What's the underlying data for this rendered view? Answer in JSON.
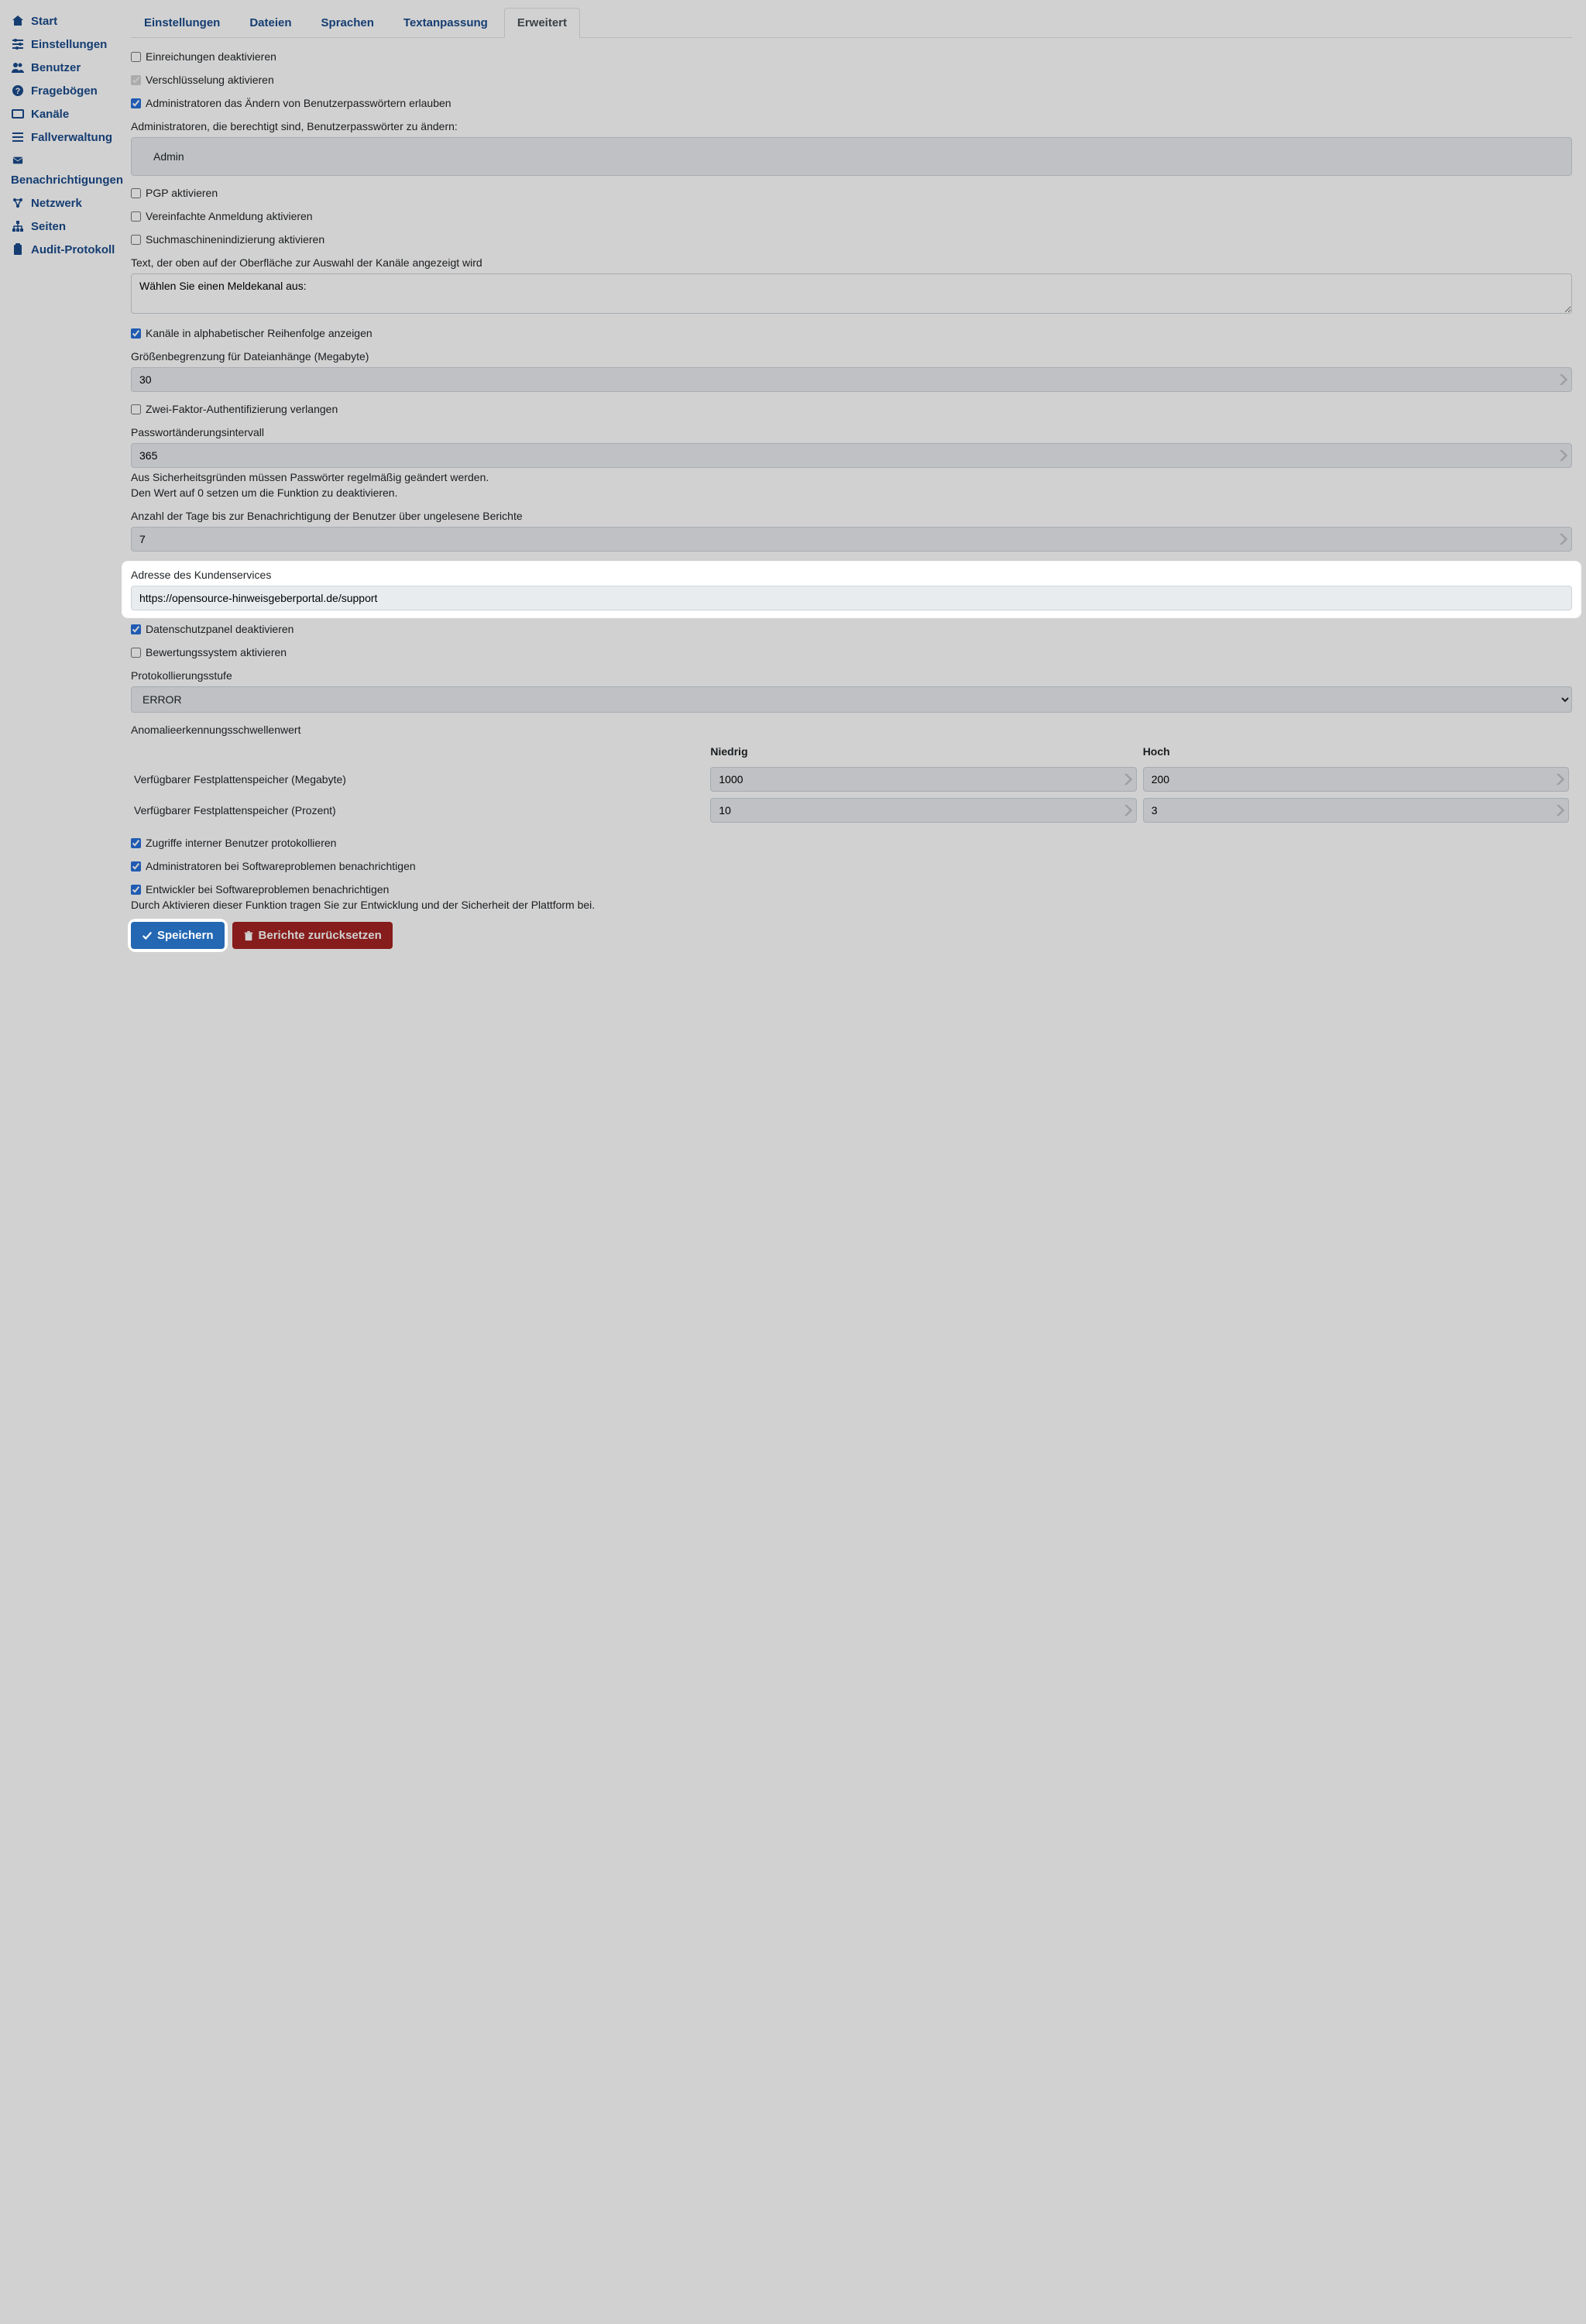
{
  "sidebar": {
    "items": [
      {
        "icon": "home",
        "label": "Start"
      },
      {
        "icon": "sliders",
        "label": "Einstellungen"
      },
      {
        "icon": "users",
        "label": "Benutzer"
      },
      {
        "icon": "question",
        "label": "Fragebögen"
      },
      {
        "icon": "inbox",
        "label": "Kanäle"
      },
      {
        "icon": "list",
        "label": "Fallverwaltung"
      },
      {
        "icon": "envelope",
        "label": "Benachrichtigungen"
      },
      {
        "icon": "cloud",
        "label": "Netzwerk"
      },
      {
        "icon": "sitemap",
        "label": "Seiten"
      },
      {
        "icon": "clipboard",
        "label": "Audit-Protokoll"
      }
    ]
  },
  "tabs": [
    "Einstellungen",
    "Dateien",
    "Sprachen",
    "Textanpassung",
    "Erweitert"
  ],
  "active_tab": "Erweitert",
  "form": {
    "disable_submissions": {
      "label": "Einreichungen deaktivieren",
      "checked": false
    },
    "enable_encryption": {
      "label": "Verschlüsselung aktivieren",
      "checked": true,
      "disabled": true
    },
    "allow_admin_pw_change": {
      "label": "Administratoren das Ändern von Benutzerpasswörtern erlauben",
      "checked": true
    },
    "admins_allowed_label": "Administratoren, die berechtigt sind, Benutzerpasswörter zu ändern:",
    "admins_allowed_value": "Admin",
    "enable_pgp": {
      "label": "PGP aktivieren",
      "checked": false
    },
    "simplified_login": {
      "label": "Vereinfachte Anmeldung aktivieren",
      "checked": false
    },
    "search_indexing": {
      "label": "Suchmaschinenindizierung aktivieren",
      "checked": false
    },
    "channel_text_label": "Text, der oben auf der Oberfläche zur Auswahl der Kanäle angezeigt wird",
    "channel_text_value": "Wählen Sie einen Meldekanal aus:",
    "channels_alpha": {
      "label": "Kanäle in alphabetischer Reihenfolge anzeigen",
      "checked": true
    },
    "attachment_size_label": "Größenbegrenzung für Dateianhänge (Megabyte)",
    "attachment_size_value": "30",
    "require_2fa": {
      "label": "Zwei-Faktor-Authentifizierung verlangen",
      "checked": false
    },
    "pw_interval_label": "Passwortänderungsintervall",
    "pw_interval_value": "365",
    "pw_interval_help1": "Aus Sicherheitsgründen müssen Passwörter regelmäßig geändert werden.",
    "pw_interval_help2": "Den Wert auf 0 setzen um die Funktion zu deaktivieren.",
    "unread_days_label": "Anzahl der Tage bis zur Benachrichtigung der Benutzer über ungelesene Berichte",
    "unread_days_value": "7",
    "custodian_label": "Adresse des Kundenservices",
    "custodian_value": "https://opensource-hinweisgeberportal.de/support",
    "disable_privacy_panel": {
      "label": "Datenschutzpanel deaktivieren",
      "checked": true
    },
    "enable_scoring": {
      "label": "Bewertungssystem aktivieren",
      "checked": false
    },
    "log_level_label": "Protokollierungsstufe",
    "log_level_value": "ERROR",
    "anomaly_label": "Anomalieerkennungsschwellenwert",
    "anomaly_cols": {
      "low": "Niedrig",
      "high": "Hoch"
    },
    "anomaly_rows": [
      {
        "label": "Verfügbarer Festplattenspeicher (Megabyte)",
        "low": "1000",
        "high": "200"
      },
      {
        "label": "Verfügbarer Festplattenspeicher (Prozent)",
        "low": "10",
        "high": "3"
      }
    ],
    "log_internal": {
      "label": "Zugriffe interner Benutzer protokollieren",
      "checked": true
    },
    "notify_admins": {
      "label": "Administratoren bei Softwareproblemen benachrichtigen",
      "checked": true
    },
    "notify_devs": {
      "label": "Entwickler bei Softwareproblemen benachrichtigen",
      "checked": true
    },
    "notify_devs_help": "Durch Aktivieren dieser Funktion tragen Sie zur Entwicklung und der Sicherheit der Plattform bei.",
    "save_label": "Speichern",
    "reset_label": "Berichte zurücksetzen"
  }
}
